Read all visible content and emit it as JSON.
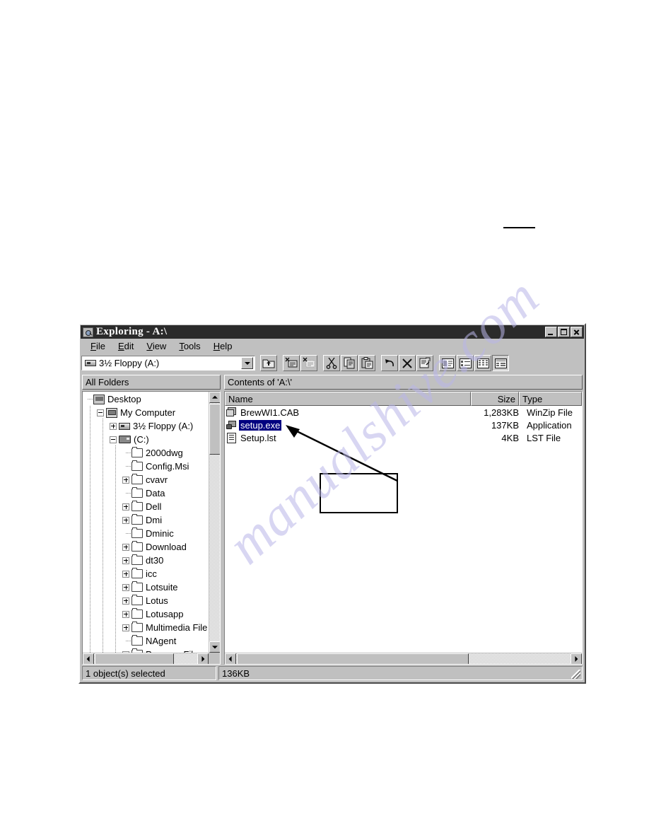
{
  "page": {
    "watermark": "manualshive.com",
    "top_rule": "horizontal-rule-mark"
  },
  "window": {
    "title": "Exploring - A:\\",
    "title_icon": "explorer-icon",
    "controls": {
      "minimize": "Minimize",
      "maximize": "Maximize",
      "close": "Close"
    }
  },
  "menu": [
    {
      "label": "File",
      "accel": "F"
    },
    {
      "label": "Edit",
      "accel": "E"
    },
    {
      "label": "View",
      "accel": "V"
    },
    {
      "label": "Tools",
      "accel": "T"
    },
    {
      "label": "Help",
      "accel": "H"
    }
  ],
  "addressbar": {
    "value": "3½ Floppy (A:)",
    "icon": "floppy-drive-icon",
    "dropdown": "chevron-down-icon"
  },
  "toolbar": {
    "buttons": [
      {
        "name": "up-one-level-button",
        "icon": "up-one-level-icon",
        "state": "raised"
      },
      {
        "name": "map-network-drive-button",
        "icon": "map-network-drive-icon",
        "state": "raised"
      },
      {
        "name": "disconnect-net-drive-button",
        "icon": "disconnect-net-drive-icon",
        "state": "raised"
      },
      {
        "name": "cut-button",
        "icon": "scissors-icon",
        "state": "raised"
      },
      {
        "name": "copy-button",
        "icon": "copy-icon",
        "state": "raised"
      },
      {
        "name": "paste-button",
        "icon": "paste-icon",
        "state": "raised"
      },
      {
        "name": "undo-button",
        "icon": "undo-arrow-icon",
        "state": "raised"
      },
      {
        "name": "delete-button",
        "icon": "delete-x-icon",
        "state": "raised"
      },
      {
        "name": "properties-button",
        "icon": "properties-icon",
        "state": "raised"
      },
      {
        "name": "view-large-icons-button",
        "icon": "large-icons-icon",
        "state": "raised"
      },
      {
        "name": "view-small-icons-button",
        "icon": "small-icons-icon",
        "state": "raised"
      },
      {
        "name": "view-list-button",
        "icon": "list-view-icon",
        "state": "raised"
      },
      {
        "name": "view-details-button",
        "icon": "details-view-icon",
        "state": "pressed"
      }
    ]
  },
  "panes": {
    "left_header": "All Folders",
    "right_header": "Contents of 'A:\\'"
  },
  "tree": {
    "nodes": [
      {
        "label": "Desktop",
        "depth": 0,
        "expander": "none",
        "icon": "desktop-icon"
      },
      {
        "label": "My Computer",
        "depth": 1,
        "expander": "minus",
        "icon": "my-computer-icon"
      },
      {
        "label": "3½ Floppy (A:)",
        "depth": 2,
        "expander": "plus",
        "icon": "floppy-drive-icon"
      },
      {
        "label": "(C:)",
        "depth": 2,
        "expander": "minus",
        "icon": "hard-drive-icon"
      },
      {
        "label": "2000dwg",
        "depth": 3,
        "expander": "none",
        "icon": "folder-icon"
      },
      {
        "label": "Config.Msi",
        "depth": 3,
        "expander": "none",
        "icon": "folder-icon"
      },
      {
        "label": "cvavr",
        "depth": 3,
        "expander": "plus",
        "icon": "folder-icon"
      },
      {
        "label": "Data",
        "depth": 3,
        "expander": "none",
        "icon": "folder-icon"
      },
      {
        "label": "Dell",
        "depth": 3,
        "expander": "plus",
        "icon": "folder-icon"
      },
      {
        "label": "Dmi",
        "depth": 3,
        "expander": "plus",
        "icon": "folder-icon"
      },
      {
        "label": "Dminic",
        "depth": 3,
        "expander": "none",
        "icon": "folder-icon"
      },
      {
        "label": "Download",
        "depth": 3,
        "expander": "plus",
        "icon": "folder-icon"
      },
      {
        "label": "dt30",
        "depth": 3,
        "expander": "plus",
        "icon": "folder-icon"
      },
      {
        "label": "icc",
        "depth": 3,
        "expander": "plus",
        "icon": "folder-icon"
      },
      {
        "label": "Lotsuite",
        "depth": 3,
        "expander": "plus",
        "icon": "folder-icon"
      },
      {
        "label": "Lotus",
        "depth": 3,
        "expander": "plus",
        "icon": "folder-icon"
      },
      {
        "label": "Lotusapp",
        "depth": 3,
        "expander": "plus",
        "icon": "folder-icon"
      },
      {
        "label": "Multimedia File",
        "depth": 3,
        "expander": "plus",
        "icon": "folder-icon"
      },
      {
        "label": "NAgent",
        "depth": 3,
        "expander": "none",
        "icon": "folder-icon"
      },
      {
        "label": "Program File",
        "depth": 3,
        "expander": "plus",
        "icon": "folder-icon"
      }
    ]
  },
  "filelist": {
    "columns": [
      {
        "key": "name",
        "label": "Name"
      },
      {
        "key": "size",
        "label": "Size"
      },
      {
        "key": "type",
        "label": "Type"
      }
    ],
    "rows": [
      {
        "name": "BrewWI1.CAB",
        "size": "1,283KB",
        "type": "WinZip File",
        "icon": "cab-file-icon",
        "selected": false
      },
      {
        "name": "setup.exe",
        "size": "137KB",
        "type": "Application",
        "icon": "exe-file-icon",
        "selected": true
      },
      {
        "name": "Setup.lst",
        "size": "4KB",
        "type": "LST File",
        "icon": "lst-file-icon",
        "selected": false
      }
    ]
  },
  "statusbar": {
    "left": "1 object(s) selected",
    "right": "136KB"
  },
  "annotation": {
    "box_text": "",
    "arrow": "callout-arrow-to-setup-exe"
  },
  "colors": {
    "window_face": "#c0c0c0",
    "titlebar": "#2b2b2b",
    "selection": "#000080",
    "watermark": "#b9b6e8",
    "text": "#000000"
  }
}
